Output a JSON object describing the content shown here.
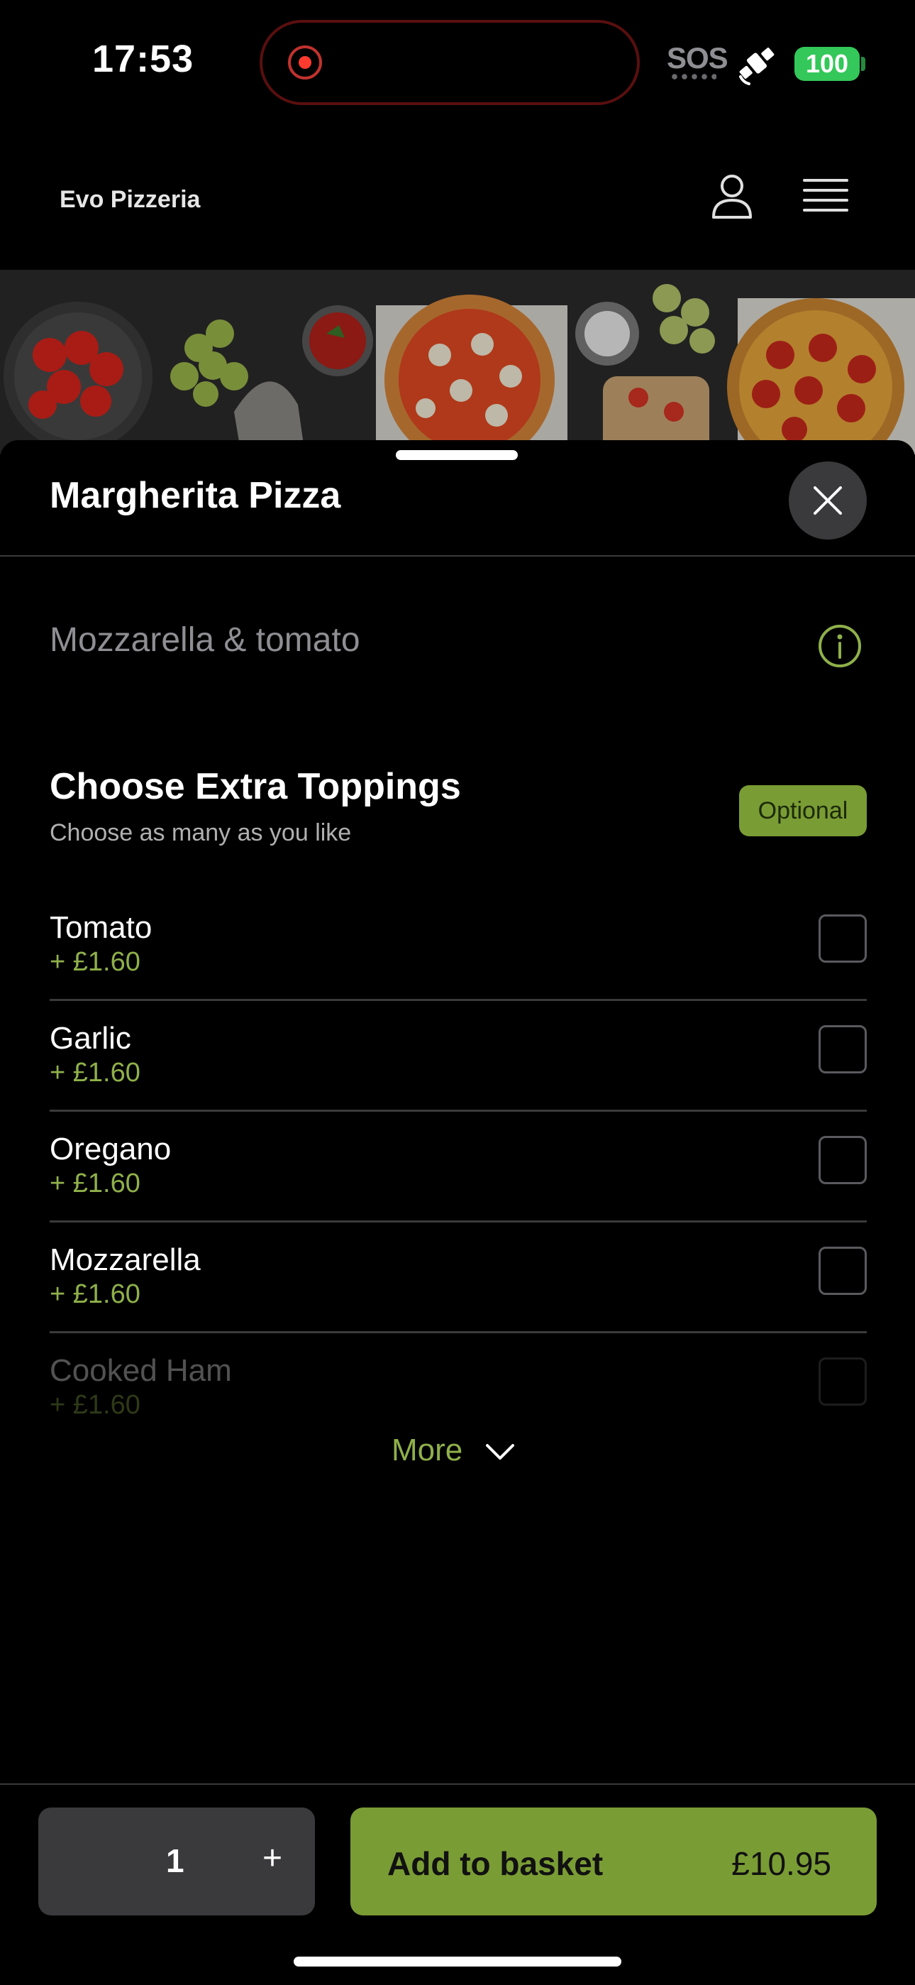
{
  "status_bar": {
    "time": "17:53",
    "sos": "SOS",
    "battery": "100"
  },
  "header": {
    "brand": "Evo Pizzeria",
    "icons": [
      "profile-icon",
      "hamburger-menu-icon"
    ]
  },
  "item": {
    "title": "Margherita Pizza",
    "description": "Mozzarella & tomato"
  },
  "toppings_section": {
    "title": "Choose Extra Toppings",
    "subtitle": "Choose as many as you like",
    "badge": "Optional",
    "items": [
      {
        "name": "Tomato",
        "price": "+ £1.60",
        "checked": false
      },
      {
        "name": "Garlic",
        "price": "+ £1.60",
        "checked": false
      },
      {
        "name": "Oregano",
        "price": "+ £1.60",
        "checked": false
      },
      {
        "name": "Mozzarella",
        "price": "+ £1.60",
        "checked": false
      },
      {
        "name": "Cooked Ham",
        "price": "+ £1.60",
        "checked": false
      }
    ],
    "more_label": "More"
  },
  "footer": {
    "quantity": "1",
    "plus": "+",
    "add_label": "Add to basket",
    "total": "£10.95"
  },
  "colors": {
    "accent": "#7a9c35",
    "accent_text": "#8fb04a",
    "background": "#000000",
    "surface": "#3a3a3c",
    "recording": "#ff3b30",
    "battery": "#34c759"
  }
}
